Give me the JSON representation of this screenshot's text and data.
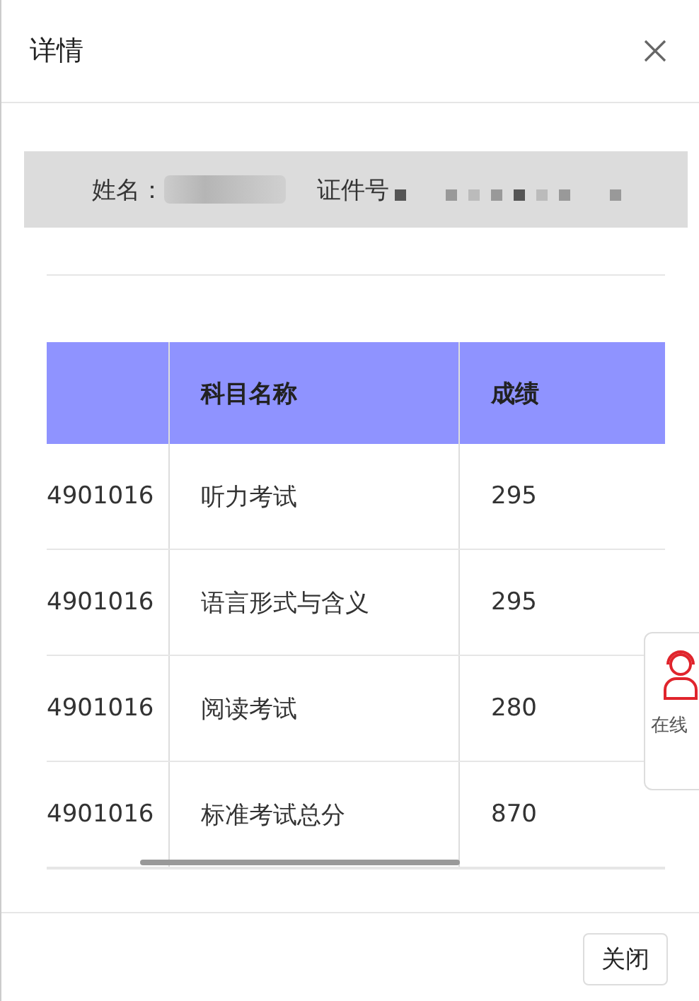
{
  "window": {
    "title": "详情"
  },
  "info": {
    "name_label": "姓名：",
    "id_label": "证件号"
  },
  "table": {
    "columns": [
      "",
      "科目名称",
      "成绩"
    ],
    "rows": [
      {
        "column_1": "4901016",
        "subject": "听力考试",
        "score": "295"
      },
      {
        "column_1": "4901016",
        "subject": "语言形式与含义",
        "score": "295"
      },
      {
        "column_1": "4901016",
        "subject": "阅读考试",
        "score": "280"
      },
      {
        "column_1": "4901016",
        "subject": "标准考试总分",
        "score": "870"
      }
    ]
  },
  "side_widget": {
    "label": "在线"
  },
  "buttons": [
    "关闭"
  ]
}
